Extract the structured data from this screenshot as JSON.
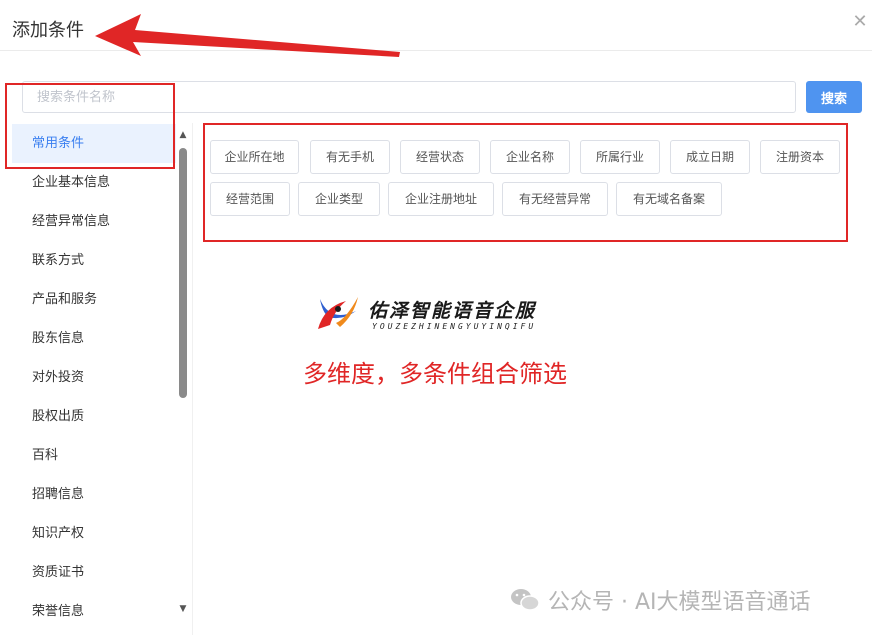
{
  "dialog": {
    "title": "添加条件"
  },
  "search": {
    "placeholder": "搜索条件名称",
    "value": "",
    "button_label": "搜索"
  },
  "sidebar": {
    "items": [
      {
        "label": "常用条件",
        "active": true
      },
      {
        "label": "企业基本信息"
      },
      {
        "label": "经营异常信息"
      },
      {
        "label": "联系方式"
      },
      {
        "label": "产品和服务"
      },
      {
        "label": "股东信息"
      },
      {
        "label": "对外投资"
      },
      {
        "label": "股权出质"
      },
      {
        "label": "百科"
      },
      {
        "label": "招聘信息"
      },
      {
        "label": "知识产权"
      },
      {
        "label": "资质证书"
      },
      {
        "label": "荣誉信息"
      }
    ]
  },
  "conditions": {
    "tags": [
      "企业所在地",
      "有无手机",
      "经营状态",
      "企业名称",
      "所属行业",
      "成立日期",
      "注册资本",
      "经营范围",
      "企业类型",
      "企业注册地址",
      "有无经营异常",
      "有无域名备案"
    ]
  },
  "branding": {
    "name": "佑泽智能语音企服",
    "pinyin": "YOUZEZHINENGYUYINQIFU",
    "headline": "多维度，多条件组合筛选"
  },
  "watermark": {
    "text": "公众号 · AI大模型语音通话"
  },
  "colors": {
    "accent": "#4f94f0",
    "annotation_red": "#e02626",
    "active_bg": "#eaf2fe",
    "active_text": "#3a7ff0"
  }
}
